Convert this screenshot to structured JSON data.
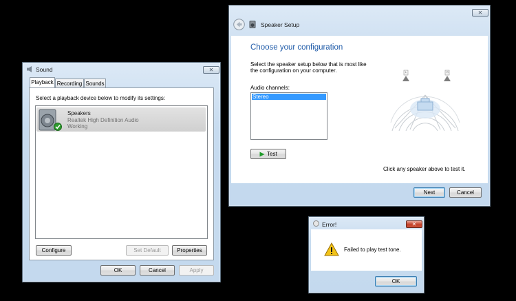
{
  "sound": {
    "title": "Sound",
    "tabs": [
      "Playback",
      "Recording",
      "Sounds"
    ],
    "instruction": "Select a playback device below to modify its settings:",
    "device": {
      "name": "Speakers",
      "driver": "Realtek High Definition Audio",
      "status": "Working"
    },
    "buttons": {
      "configure": "Configure",
      "set_default": "Set Default",
      "properties": "Properties",
      "ok": "OK",
      "cancel": "Cancel",
      "apply": "Apply"
    },
    "close": "✕"
  },
  "speaker_setup": {
    "title": "Speaker Setup",
    "heading": "Choose your configuration",
    "description_line1": "Select the speaker setup below that is most like",
    "description_line2": "the configuration on your computer.",
    "audio_channels_label": "Audio channels:",
    "channels": [
      "Stereo"
    ],
    "test_button": "Test",
    "hint": "Click any speaker above to test it.",
    "next_button": "Next",
    "cancel_button": "Cancel",
    "speaker_left": "L",
    "speaker_right": "R",
    "close": "✕",
    "heading_color": "#1e5aa8"
  },
  "error": {
    "title": "Error!",
    "message": "Failed to play test tone.",
    "ok_button": "OK",
    "close": "✕"
  }
}
